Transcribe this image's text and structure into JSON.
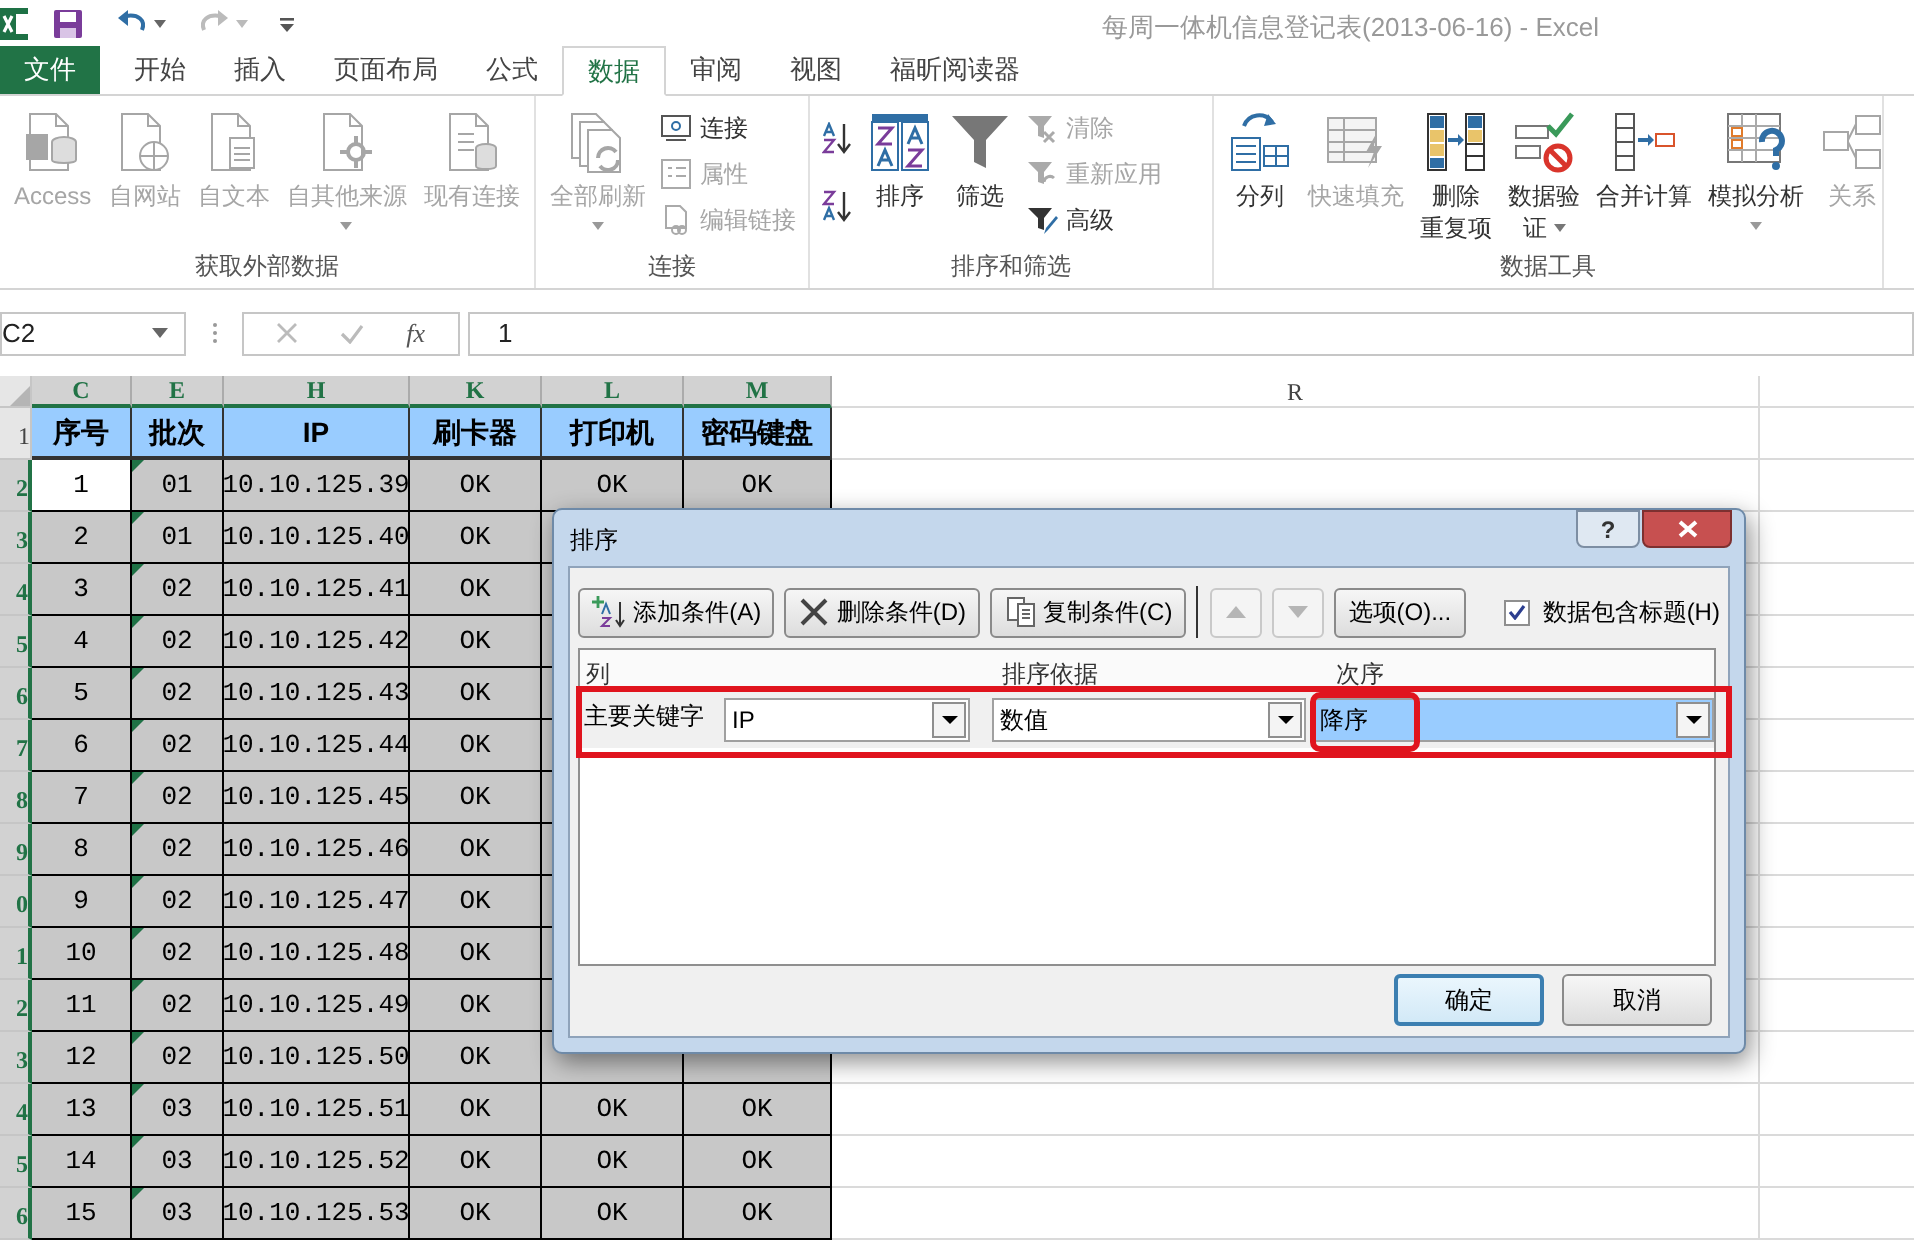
{
  "window": {
    "title": "每周一体机信息登记表(2013-06-16) - Excel"
  },
  "tabs": [
    {
      "label": "文件",
      "kind": "file",
      "selected": false
    },
    {
      "label": "开始",
      "kind": "tab",
      "selected": false
    },
    {
      "label": "插入",
      "kind": "tab",
      "selected": false
    },
    {
      "label": "页面布局",
      "kind": "tab",
      "selected": false
    },
    {
      "label": "公式",
      "kind": "tab",
      "selected": false
    },
    {
      "label": "数据",
      "kind": "tab",
      "selected": true
    },
    {
      "label": "审阅",
      "kind": "tab",
      "selected": false
    },
    {
      "label": "视图",
      "kind": "tab",
      "selected": false
    },
    {
      "label": "福昕阅读器",
      "kind": "tab",
      "selected": false
    }
  ],
  "ribbon_groups": [
    {
      "label": "获取外部数据",
      "buttons": [
        {
          "kind": "large",
          "label": "Access",
          "disabled": true,
          "dropdown": false
        },
        {
          "kind": "large",
          "label": "自网站",
          "disabled": true,
          "dropdown": false
        },
        {
          "kind": "large",
          "label": "自文本",
          "disabled": true,
          "dropdown": false
        },
        {
          "kind": "large",
          "label": "自其他来源",
          "disabled": true,
          "dropdown": true
        },
        {
          "kind": "large",
          "label": "现有连接",
          "disabled": true,
          "dropdown": false
        }
      ]
    },
    {
      "label": "连接",
      "buttons": [
        {
          "kind": "large",
          "label": "全部刷新",
          "disabled": true,
          "dropdown": true
        },
        {
          "kind": "small",
          "label": "连接",
          "disabled": false
        },
        {
          "kind": "small",
          "label": "属性",
          "disabled": true
        },
        {
          "kind": "small",
          "label": "编辑链接",
          "disabled": true
        }
      ]
    },
    {
      "label": "排序和筛选",
      "buttons": [
        {
          "kind": "small",
          "disabled": false
        },
        {
          "kind": "small",
          "disabled": false
        },
        {
          "kind": "large",
          "label": "排序",
          "disabled": false,
          "dropdown": false
        },
        {
          "kind": "large",
          "label": "筛选",
          "disabled": false,
          "dropdown": false
        },
        {
          "kind": "small",
          "label": "清除",
          "disabled": true
        },
        {
          "kind": "small",
          "label": "重新应用",
          "disabled": true
        },
        {
          "kind": "small",
          "label": "高级",
          "disabled": false
        }
      ]
    },
    {
      "label": "数据工具",
      "buttons": [
        {
          "kind": "large",
          "label": "分列",
          "disabled": false,
          "dropdown": false
        },
        {
          "kind": "large",
          "label": "快速填充",
          "disabled": true,
          "dropdown": false
        },
        {
          "kind": "large",
          "label": "删除",
          "label_2": "重复项",
          "disabled": false,
          "dropdown": false
        },
        {
          "kind": "large",
          "label": "数据验",
          "label_2": "证",
          "disabled": false,
          "dropdown": true
        },
        {
          "kind": "large",
          "label": "合并计算",
          "disabled": false,
          "dropdown": false
        },
        {
          "kind": "large",
          "label": "模拟分析",
          "disabled": false,
          "dropdown": true
        },
        {
          "kind": "large",
          "label": "关系",
          "disabled": true,
          "dropdown": false
        }
      ]
    }
  ],
  "formula_bar": {
    "name_box": "C2",
    "function_symbol": "fx",
    "formula": "1"
  },
  "sheet": {
    "columns": [
      {
        "label": "C",
        "selected": true
      },
      {
        "label": "E",
        "selected": true
      },
      {
        "label": "H",
        "selected": true
      },
      {
        "label": "K",
        "selected": true
      },
      {
        "label": "L",
        "selected": true
      },
      {
        "label": "M",
        "selected": true
      },
      {
        "label": "R",
        "selected": false
      }
    ],
    "rows": [
      {
        "row_label": "1",
        "kind": "header",
        "selected": false,
        "cells": [
          "序号",
          "批次",
          "IP",
          "刷卡器",
          "打印机",
          "密码键盘"
        ]
      },
      {
        "row_label": "2",
        "kind": "data",
        "selected": true,
        "first_cell_active": true,
        "error_flag": true,
        "cells": [
          "1",
          "01",
          "10.10.125.39",
          "OK",
          "OK",
          "OK"
        ]
      },
      {
        "row_label": "3",
        "kind": "data",
        "selected": true,
        "first_cell_active": false,
        "error_flag": true,
        "cells": [
          "2",
          "01",
          "10.10.125.40",
          "OK"
        ]
      },
      {
        "row_label": "4",
        "kind": "data",
        "selected": true,
        "first_cell_active": false,
        "error_flag": true,
        "cells": [
          "3",
          "02",
          "10.10.125.41",
          "OK"
        ]
      },
      {
        "row_label": "5",
        "kind": "data",
        "selected": true,
        "first_cell_active": false,
        "error_flag": true,
        "cells": [
          "4",
          "02",
          "10.10.125.42",
          "OK"
        ]
      },
      {
        "row_label": "6",
        "kind": "data",
        "selected": true,
        "first_cell_active": false,
        "error_flag": true,
        "cells": [
          "5",
          "02",
          "10.10.125.43",
          "OK"
        ]
      },
      {
        "row_label": "7",
        "kind": "data",
        "selected": true,
        "first_cell_active": false,
        "error_flag": true,
        "cells": [
          "6",
          "02",
          "10.10.125.44",
          "OK"
        ]
      },
      {
        "row_label": "8",
        "kind": "data",
        "selected": true,
        "first_cell_active": false,
        "error_flag": true,
        "cells": [
          "7",
          "02",
          "10.10.125.45",
          "OK"
        ]
      },
      {
        "row_label": "9",
        "kind": "data",
        "selected": true,
        "first_cell_active": false,
        "error_flag": true,
        "cells": [
          "8",
          "02",
          "10.10.125.46",
          "OK"
        ]
      },
      {
        "row_label": "0",
        "kind": "data",
        "selected": true,
        "first_cell_active": false,
        "error_flag": true,
        "cells": [
          "9",
          "02",
          "10.10.125.47",
          "OK"
        ]
      },
      {
        "row_label": "1",
        "kind": "data",
        "selected": true,
        "first_cell_active": false,
        "error_flag": true,
        "cells": [
          "10",
          "02",
          "10.10.125.48",
          "OK"
        ]
      },
      {
        "row_label": "2",
        "kind": "data",
        "selected": true,
        "first_cell_active": false,
        "error_flag": true,
        "cells": [
          "11",
          "02",
          "10.10.125.49",
          "OK"
        ]
      },
      {
        "row_label": "3",
        "kind": "data",
        "selected": true,
        "first_cell_active": false,
        "error_flag": true,
        "cells": [
          "12",
          "02",
          "10.10.125.50",
          "OK"
        ]
      },
      {
        "row_label": "4",
        "kind": "data",
        "selected": true,
        "first_cell_active": false,
        "error_flag": true,
        "cells": [
          "13",
          "03",
          "10.10.125.51",
          "OK",
          "OK",
          "OK"
        ]
      },
      {
        "row_label": "5",
        "kind": "data",
        "selected": true,
        "first_cell_active": false,
        "error_flag": true,
        "cells": [
          "14",
          "03",
          "10.10.125.52",
          "OK",
          "OK",
          "OK"
        ]
      },
      {
        "row_label": "6",
        "kind": "data",
        "selected": true,
        "first_cell_active": false,
        "error_flag": true,
        "cells": [
          "15",
          "03",
          "10.10.125.53",
          "OK",
          "OK",
          "OK"
        ]
      }
    ]
  },
  "sort_dialog": {
    "title": "排序",
    "help": "?",
    "toolbar": [
      {
        "kind": "add",
        "label": "添加条件(A)",
        "disabled": false
      },
      {
        "kind": "delete",
        "label": "删除条件(D)",
        "disabled": false
      },
      {
        "kind": "copy",
        "label": "复制条件(C)",
        "disabled": false
      },
      {
        "kind": "up",
        "disabled": true
      },
      {
        "kind": "down",
        "disabled": true
      },
      {
        "kind": "text",
        "label": "选项(O)...",
        "disabled": false
      }
    ],
    "header_checkbox": {
      "label": "数据包含标题(H)",
      "checked": true
    },
    "columns": [
      "列",
      "排序依据",
      "次序"
    ],
    "levels": [
      {
        "label": "主要关键字",
        "column": "IP",
        "sort_on": "数值",
        "order": "降序",
        "selected": true,
        "framed": true,
        "order_framed": true
      }
    ],
    "buttons": [
      {
        "label": "确定",
        "default": true
      },
      {
        "label": "取消",
        "default": false
      }
    ]
  }
}
